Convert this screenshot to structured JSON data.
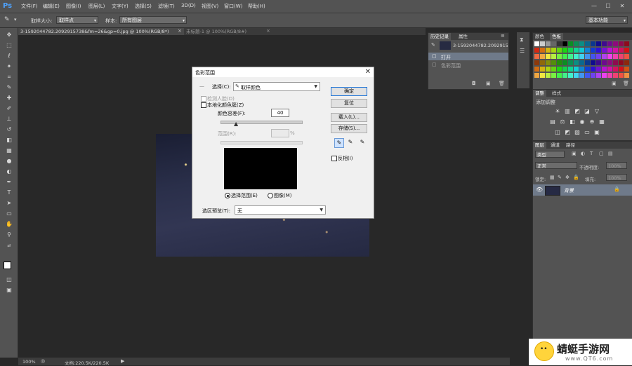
{
  "app": {
    "logo": "Ps",
    "menu": [
      "文件(F)",
      "编辑(E)",
      "图像(I)",
      "图层(L)",
      "文字(Y)",
      "选择(S)",
      "滤镜(T)",
      "3D(D)",
      "视图(V)",
      "窗口(W)",
      "帮助(H)"
    ],
    "window_controls": [
      "—",
      "☐",
      "✕"
    ],
    "workspace_selector": "基本功能"
  },
  "options_bar": {
    "sample_size_label": "取样大小:",
    "sample_size_value": "取样点",
    "sample_label": "样本:",
    "sample_value": "所有图层"
  },
  "tabs": {
    "doc_tab_1": "3-1592044782.2092915738&fm=26&gp=0.jpg @ 100%(RGB/8*)",
    "doc_tab_2": "未标题-1 @ 100%(RGB/8#)"
  },
  "dialog": {
    "title": "色彩范围",
    "select_label": "选择(C):",
    "select_value": "取样颜色",
    "detect_faces_label": "检测人脸(D)",
    "localized_clusters_label": "本地化颜色簇(Z)",
    "fuzziness_label": "颜色容差(F):",
    "fuzziness_value": "40",
    "range_label": "范围(R):",
    "range_unit": "%",
    "selection_radio": "选择范围(E)",
    "image_radio": "图像(M)",
    "preview_label": "选区预览(T):",
    "preview_value": "无",
    "ok_button": "确定",
    "cancel_button": "复位",
    "load_button": "载入(L)...",
    "save_button": "存储(S)...",
    "invert_label": "反相(I)"
  },
  "panels": {
    "history_tabs": [
      "历史记录",
      "属性"
    ],
    "history_snapshot": "3-1592044782.2092915...",
    "history_step": "打开",
    "history_step_2": "色彩范围",
    "color_tabs": [
      "颜色",
      "色板"
    ],
    "adjust_tabs": [
      "调整",
      "样式"
    ],
    "adjust_title": "添加调整",
    "layers_tabs": [
      "图层",
      "通道",
      "路径"
    ],
    "layers_kind": "类型",
    "layers_blend": "正常",
    "layers_opacity_label": "不透明度:",
    "layers_opacity": "100%",
    "layers_lock_label": "锁定:",
    "layers_fill_label": "填充:",
    "layers_fill": "100%",
    "layer_name": "背景"
  },
  "status": {
    "zoom": "100%",
    "doc_info": "文档:220.5K/220.5K"
  },
  "watermark": {
    "text": "蜻蜓手游网",
    "url": "www.QT6.com"
  },
  "colors": {
    "chrome": "#535353",
    "workspace": "#282828",
    "dialog_bg": "#f0f0f0",
    "accent": "#1e73d6"
  }
}
